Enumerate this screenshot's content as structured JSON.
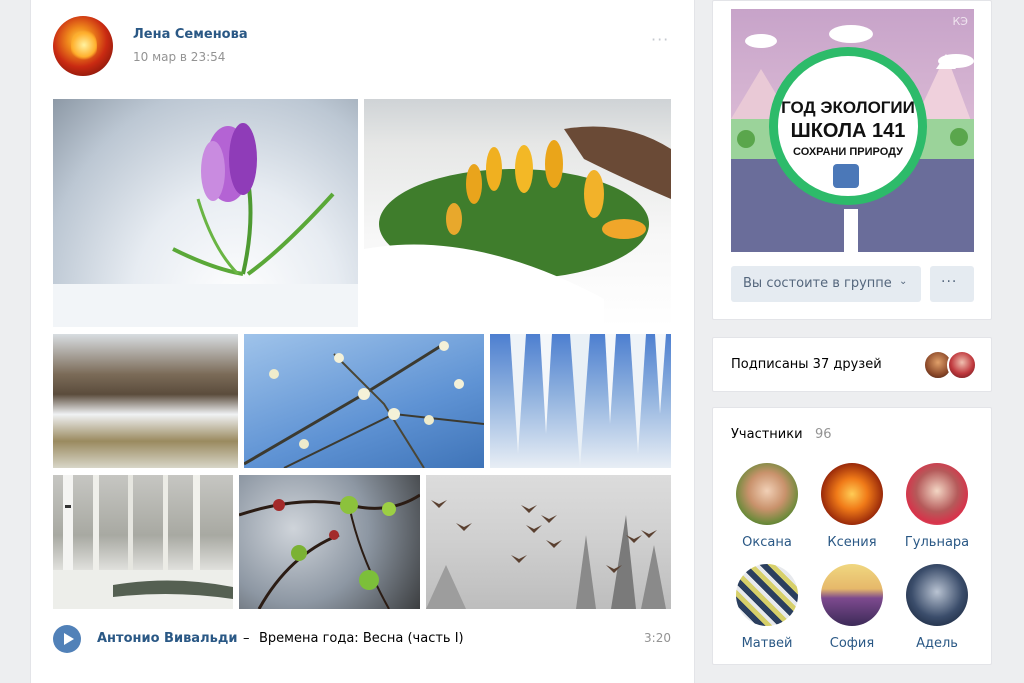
{
  "post": {
    "author": "Лена Семенова",
    "date": "10 мар в 23:54",
    "more": "···",
    "photos": [
      {
        "alt": "Крокус в снегу"
      },
      {
        "alt": "Жёлтые крокусы в снегу"
      },
      {
        "alt": "Весенний ручей"
      },
      {
        "alt": "Цветущие ветки"
      },
      {
        "alt": "Сосульки"
      },
      {
        "alt": "Берёзовый лес"
      },
      {
        "alt": "Распускающиеся почки"
      },
      {
        "alt": "Перелётные птицы"
      }
    ],
    "audio": {
      "artist": "Антонио Вивальди",
      "separator": "–",
      "title": "Времена года: Весна (часть I)",
      "duration": "3:20"
    }
  },
  "group": {
    "cover": {
      "line1": "ГОД ЭКОЛОГИИ",
      "line2": "ШКОЛА 141",
      "line3": "СОХРАНИ ПРИРОДУ",
      "watermark": "КЭ"
    },
    "member_button": "Вы состоите в группе",
    "more_button": "···"
  },
  "friends": {
    "label": "Подписаны 37 друзей"
  },
  "members": {
    "title": "Участники",
    "count": "96",
    "list": [
      {
        "name": "Оксана"
      },
      {
        "name": "Ксения"
      },
      {
        "name": "Гульнара"
      },
      {
        "name": "Матвей"
      },
      {
        "name": "София"
      },
      {
        "name": "Адель"
      }
    ]
  },
  "colors": {
    "link": "#2a5885",
    "button_bg": "#e5ebf1",
    "play": "#5181b8",
    "page_bg": "#edeef0"
  }
}
